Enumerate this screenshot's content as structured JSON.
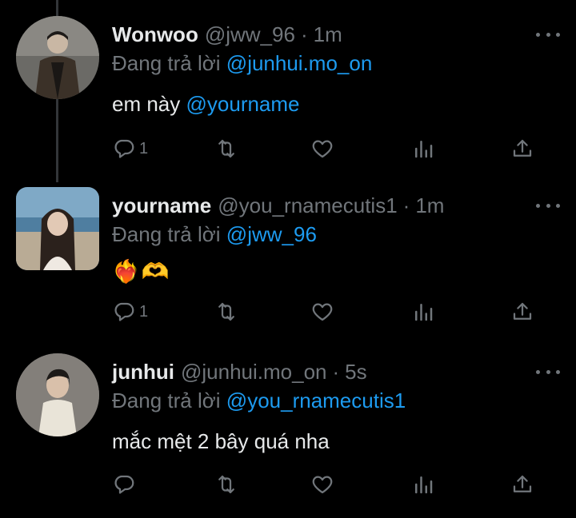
{
  "colors": {
    "background": "#000000",
    "text": "#e7e9ea",
    "muted": "#71767b",
    "accent": "#1d9bf0",
    "thread_line": "#333639"
  },
  "replying_prefix": "Đang trả lời",
  "tweets": [
    {
      "name": "Wonwoo",
      "handle": "@jww_96",
      "time": "1m",
      "replying_to": "@junhui.mo_on",
      "text": "em này",
      "text_mention": "@yourname",
      "reply_count": "1",
      "avatar_icon": "profile-photo"
    },
    {
      "name": "yourname",
      "handle": "@you_rnamecutis1",
      "time": "1m",
      "replying_to": "@jww_96",
      "text": "❤️‍🔥🫶",
      "reply_count": "1",
      "avatar_icon": "profile-photo"
    },
    {
      "name": "junhui",
      "handle": "@junhui.mo_on",
      "time": "5s",
      "replying_to": "@you_rnamecutis1",
      "text": "mắc mệt 2 bây quá nha",
      "reply_count": "",
      "avatar_icon": "profile-photo"
    }
  ],
  "icons": {
    "reply": "reply-icon",
    "retweet": "retweet-icon",
    "like": "like-icon",
    "views": "views-icon",
    "share": "share-icon",
    "more": "more-icon"
  }
}
